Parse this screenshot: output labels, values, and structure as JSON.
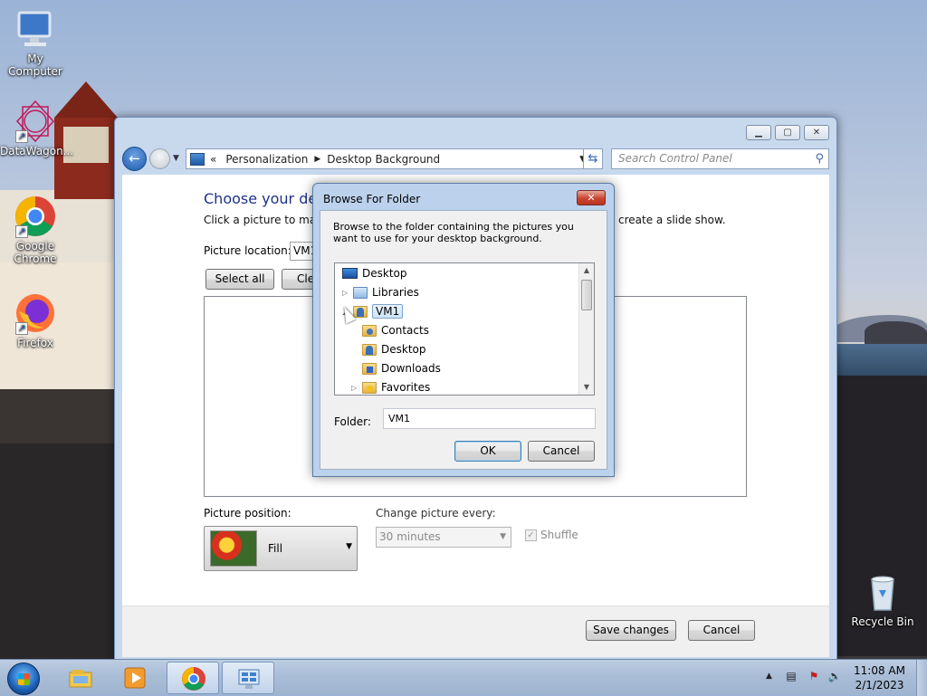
{
  "desktop": {
    "icons": [
      {
        "label": "My Computer",
        "icon": "computer-icon"
      },
      {
        "label": "DataWagon...",
        "icon": "datawagon-icon"
      },
      {
        "label": "Google Chrome",
        "icon": "chrome-icon"
      },
      {
        "label": "Firefox",
        "icon": "firefox-icon"
      },
      {
        "label": "Recycle Bin",
        "icon": "recycle-bin-icon"
      }
    ]
  },
  "control_panel": {
    "breadcrumb_prefix": "«",
    "breadcrumb": [
      "Personalization",
      "Desktop Background"
    ],
    "search_placeholder": "Search Control Panel",
    "heading": "Choose your desk",
    "subtext_left": "Click a picture to make",
    "subtext_right": "create a slide show.",
    "picture_location_label": "Picture location:",
    "picture_location_value": "VM1",
    "select_all": "Select all",
    "clear_all": "Clea",
    "picture_position_label": "Picture position:",
    "picture_position_value": "Fill",
    "change_every_label": "Change picture every:",
    "change_every_value": "30 minutes",
    "shuffle_label": "Shuffle",
    "shuffle_checked": true,
    "save_changes": "Save changes",
    "cancel": "Cancel"
  },
  "dialog": {
    "title": "Browse For Folder",
    "close": "✕",
    "description": "Browse to the folder containing the pictures you want to use for your desktop background.",
    "tree": [
      {
        "label": "Desktop",
        "level": 0,
        "icon": "desktop-icon",
        "expander": ""
      },
      {
        "label": "Libraries",
        "level": 1,
        "icon": "libraries-icon",
        "expander": "▷"
      },
      {
        "label": "VM1",
        "level": 1,
        "icon": "user-folder-icon",
        "expander": "◢",
        "selected": true
      },
      {
        "label": "Contacts",
        "level": 2,
        "icon": "contacts-folder-icon",
        "expander": ""
      },
      {
        "label": "Desktop",
        "level": 2,
        "icon": "desktop-folder-icon",
        "expander": ""
      },
      {
        "label": "Downloads",
        "level": 2,
        "icon": "downloads-folder-icon",
        "expander": ""
      },
      {
        "label": "Favorites",
        "level": 2,
        "icon": "favorites-folder-icon",
        "expander": "▷"
      }
    ],
    "folder_label": "Folder:",
    "folder_value": "VM1",
    "ok": "OK",
    "cancel": "Cancel"
  },
  "taskbar": {
    "items": [
      "explorer-icon",
      "media-player-icon",
      "chrome-icon",
      "control-panel-icon"
    ],
    "time": "11:08 AM",
    "date": "2/1/2023"
  }
}
